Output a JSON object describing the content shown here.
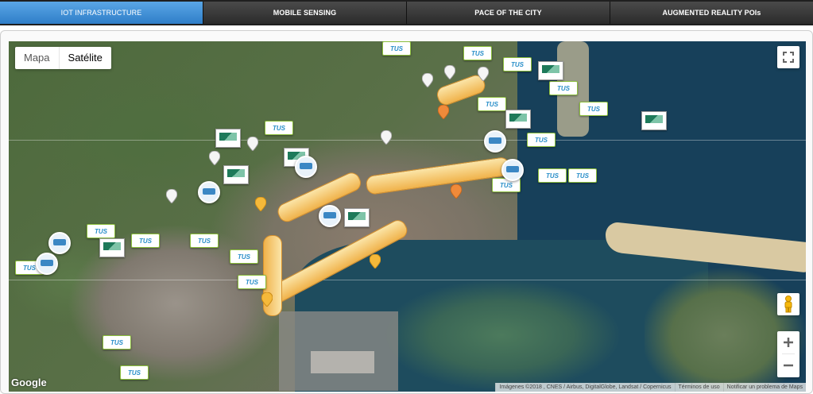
{
  "tabs": [
    {
      "label": "IOT INFRASTRUCTURE",
      "active": true
    },
    {
      "label": "MOBILE SENSING",
      "active": false
    },
    {
      "label": "PACE OF THE CITY",
      "active": false
    },
    {
      "label": "AUGMENTED REALITY POIs",
      "active": false
    }
  ],
  "map": {
    "type_controls": {
      "map_label": "Mapa",
      "satellite_label": "Satélite",
      "selected": "Satélite"
    },
    "logo": "Google",
    "attribution": {
      "imagery": "Imágenes ©2018 , CNES / Airbus, DigitalGlobe, Landsat / Copernicus",
      "terms": "Términos de uso",
      "report": "Notificar un problema de Maps"
    },
    "marker_labels": {
      "bus": "TUS"
    },
    "icons": [
      "fullscreen-icon",
      "pegman-icon",
      "zoom-in-icon",
      "zoom-out-icon"
    ],
    "colors": {
      "active_tab": "#3f8fd6",
      "tab_bar": "#2b2b2b",
      "marker_trail": "#f0b24a"
    }
  }
}
